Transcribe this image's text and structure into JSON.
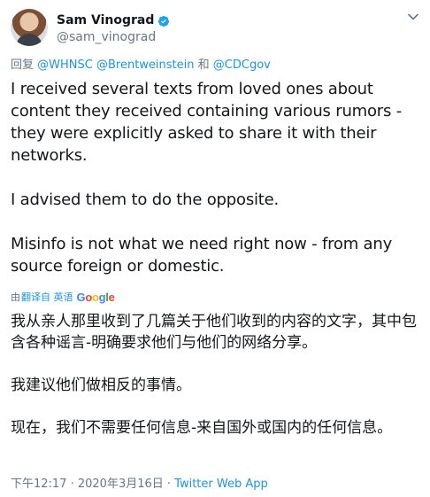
{
  "author": {
    "display_name": "Sam Vinograd",
    "handle": "@sam_vinograd",
    "verified": true
  },
  "reply": {
    "prefix": "回复",
    "mention1": "@WHNSC",
    "mention2": "@Brentweinstein",
    "joiner": "和",
    "mention3": "@CDCgov"
  },
  "tweet": {
    "text": "I received several texts from loved ones about content they received containing various rumors - they were explicitly asked to share it with their networks.\n\nI advised them to do the opposite.\n\nMisinfo is not what we need right now - from any source foreign or domestic."
  },
  "translation": {
    "by_prefix": "由",
    "link_label": "翻译自 英语",
    "provider": "Google",
    "text": "我从亲人那里收到了几篇关于他们收到的内容的文字，其中包含各种谣言-明确要求他们与他们的网络分享。\n\n我建议他们做相反的事情。\n\n现在，我们不需要任何信息-来自国外或国内的任何信息。"
  },
  "meta": {
    "timestamp": "下午12:17 · 2020年3月16日",
    "separator": " · ",
    "source": "Twitter Web App"
  },
  "colors": {
    "link": "#1b95e0",
    "muted": "#657786",
    "text": "#14171a"
  },
  "icons": {
    "verified": "verified-badge-icon",
    "menu": "chevron-down-icon"
  }
}
